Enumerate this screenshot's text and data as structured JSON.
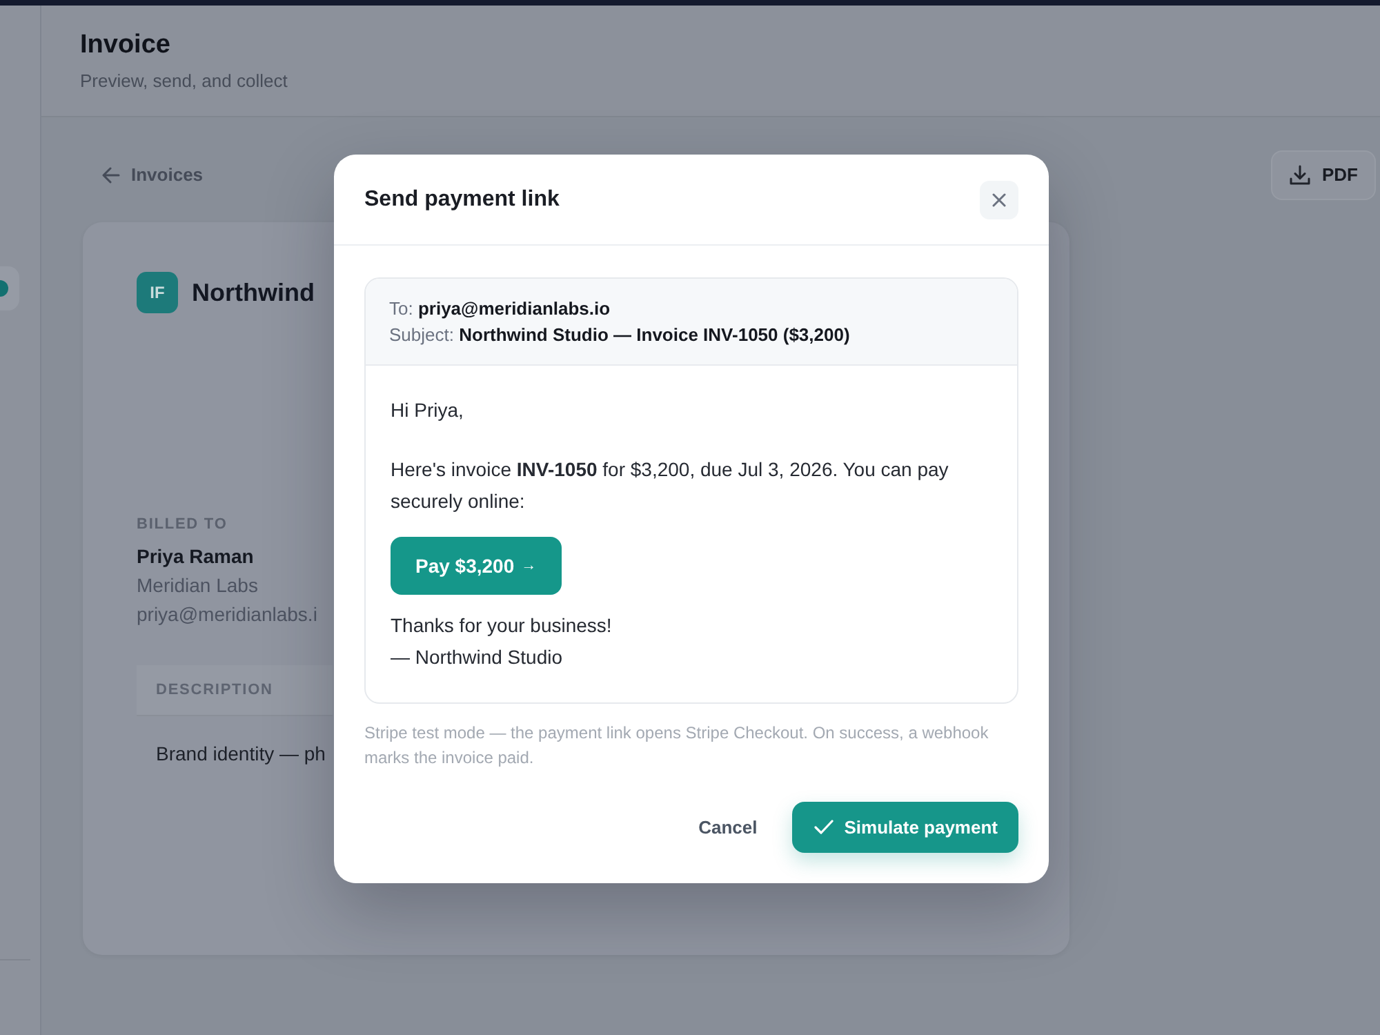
{
  "header": {
    "title": "Invoice",
    "subtitle": "Preview, send, and collect"
  },
  "back_link": {
    "label": "Invoices"
  },
  "pdf_button": {
    "label": "PDF"
  },
  "invoice_card": {
    "logo_initials": "IF",
    "company": "Northwind",
    "billed_to": {
      "heading": "BILLED TO",
      "name": "Priya Raman",
      "company": "Meridian Labs",
      "email": "priya@meridianlabs.i"
    },
    "table": {
      "columns": [
        "DESCRIPTION"
      ],
      "rows": [
        [
          "Brand identity — ph"
        ]
      ]
    }
  },
  "modal": {
    "title": "Send payment link",
    "email": {
      "fields": [
        {
          "label": "To:",
          "value": "priya@meridianlabs.io"
        },
        {
          "label": "Subject:",
          "value": "Northwind Studio — Invoice INV-1050 ($3,200)"
        }
      ],
      "greeting": "Hi Priya,",
      "message": "Here's invoice **INV-1050** for $3,200, due Jul 3, 2026. You can pay securely online:",
      "pay_button": {
        "label": "Pay $3,200",
        "arrow": "→"
      },
      "closing": [
        "Thanks for your business!",
        "— Northwind Studio"
      ]
    },
    "note": "Stripe test mode — the payment link opens Stripe Checkout. On success, a webhook marks the invoice paid.",
    "buttons": [
      {
        "kind": "secondary",
        "label": "Cancel"
      },
      {
        "kind": "primary",
        "label": "Simulate payment"
      }
    ]
  }
}
